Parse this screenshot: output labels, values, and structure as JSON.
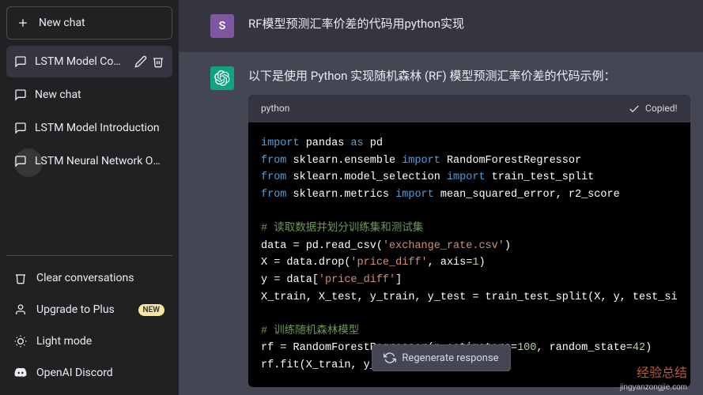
{
  "sidebar": {
    "new_chat": "New chat",
    "items": [
      {
        "label": "LSTM Model Code Sa"
      },
      {
        "label": "New chat"
      },
      {
        "label": "LSTM Model Introduction"
      },
      {
        "label": "LSTM Neural Network Overvi"
      }
    ],
    "footer": {
      "clear": "Clear conversations",
      "upgrade": "Upgrade to Plus",
      "upgrade_badge": "NEW",
      "light": "Light mode",
      "discord": "OpenAI Discord"
    }
  },
  "chat": {
    "user_avatar_letter": "S",
    "user_message": "RF模型预测汇率价差的代码用python实现",
    "assistant_intro": "以下是使用 Python 实现随机森林 (RF) 模型预测汇率价差的代码示例：",
    "code_lang": "python",
    "copied_label": "Copied!",
    "code_lines": [
      {
        "t": "import",
        "parts": [
          "import",
          " pandas ",
          "as",
          " pd"
        ]
      },
      {
        "t": "from",
        "parts": [
          "from",
          " sklearn.ensemble ",
          "import",
          " RandomForestRegressor"
        ]
      },
      {
        "t": "from",
        "parts": [
          "from",
          " sklearn.model_selection ",
          "import",
          " train_test_split"
        ]
      },
      {
        "t": "from",
        "parts": [
          "from",
          " sklearn.metrics ",
          "import",
          " mean_squared_error, r2_score"
        ]
      },
      {
        "t": "blank"
      },
      {
        "t": "comment",
        "text": "# 读取数据并划分训练集和测试集"
      },
      {
        "t": "plain",
        "segments": [
          [
            "",
            "data = pd.read_csv("
          ],
          [
            "str",
            "'exchange_rate.csv'"
          ],
          [
            "",
            ")"
          ]
        ]
      },
      {
        "t": "plain",
        "segments": [
          [
            "",
            "X = data.drop("
          ],
          [
            "str",
            "'price_diff'"
          ],
          [
            "",
            ", axis="
          ],
          [
            "num",
            "1"
          ],
          [
            "",
            ")"
          ]
        ]
      },
      {
        "t": "plain",
        "segments": [
          [
            "",
            "y = data["
          ],
          [
            "str",
            "'price_diff'"
          ],
          [
            "",
            "]"
          ]
        ]
      },
      {
        "t": "plain",
        "segments": [
          [
            "",
            "X_train, X_test, y_train, y_test = train_test_split(X, y, test_si"
          ]
        ]
      },
      {
        "t": "blank"
      },
      {
        "t": "comment",
        "text": "# 训练随机森林模型"
      },
      {
        "t": "plain",
        "segments": [
          [
            "",
            "rf = RandomForestRegressor(n_estimators="
          ],
          [
            "num",
            "100"
          ],
          [
            "",
            ", random_state="
          ],
          [
            "num",
            "42"
          ],
          [
            "",
            ")"
          ]
        ]
      },
      {
        "t": "plain",
        "segments": [
          [
            "",
            "rf.fit(X_train, y_tra"
          ]
        ]
      }
    ],
    "regenerate": "Regenerate response"
  },
  "watermark": {
    "main": "经验总结",
    "sub": "jingyanzongjie.com"
  }
}
